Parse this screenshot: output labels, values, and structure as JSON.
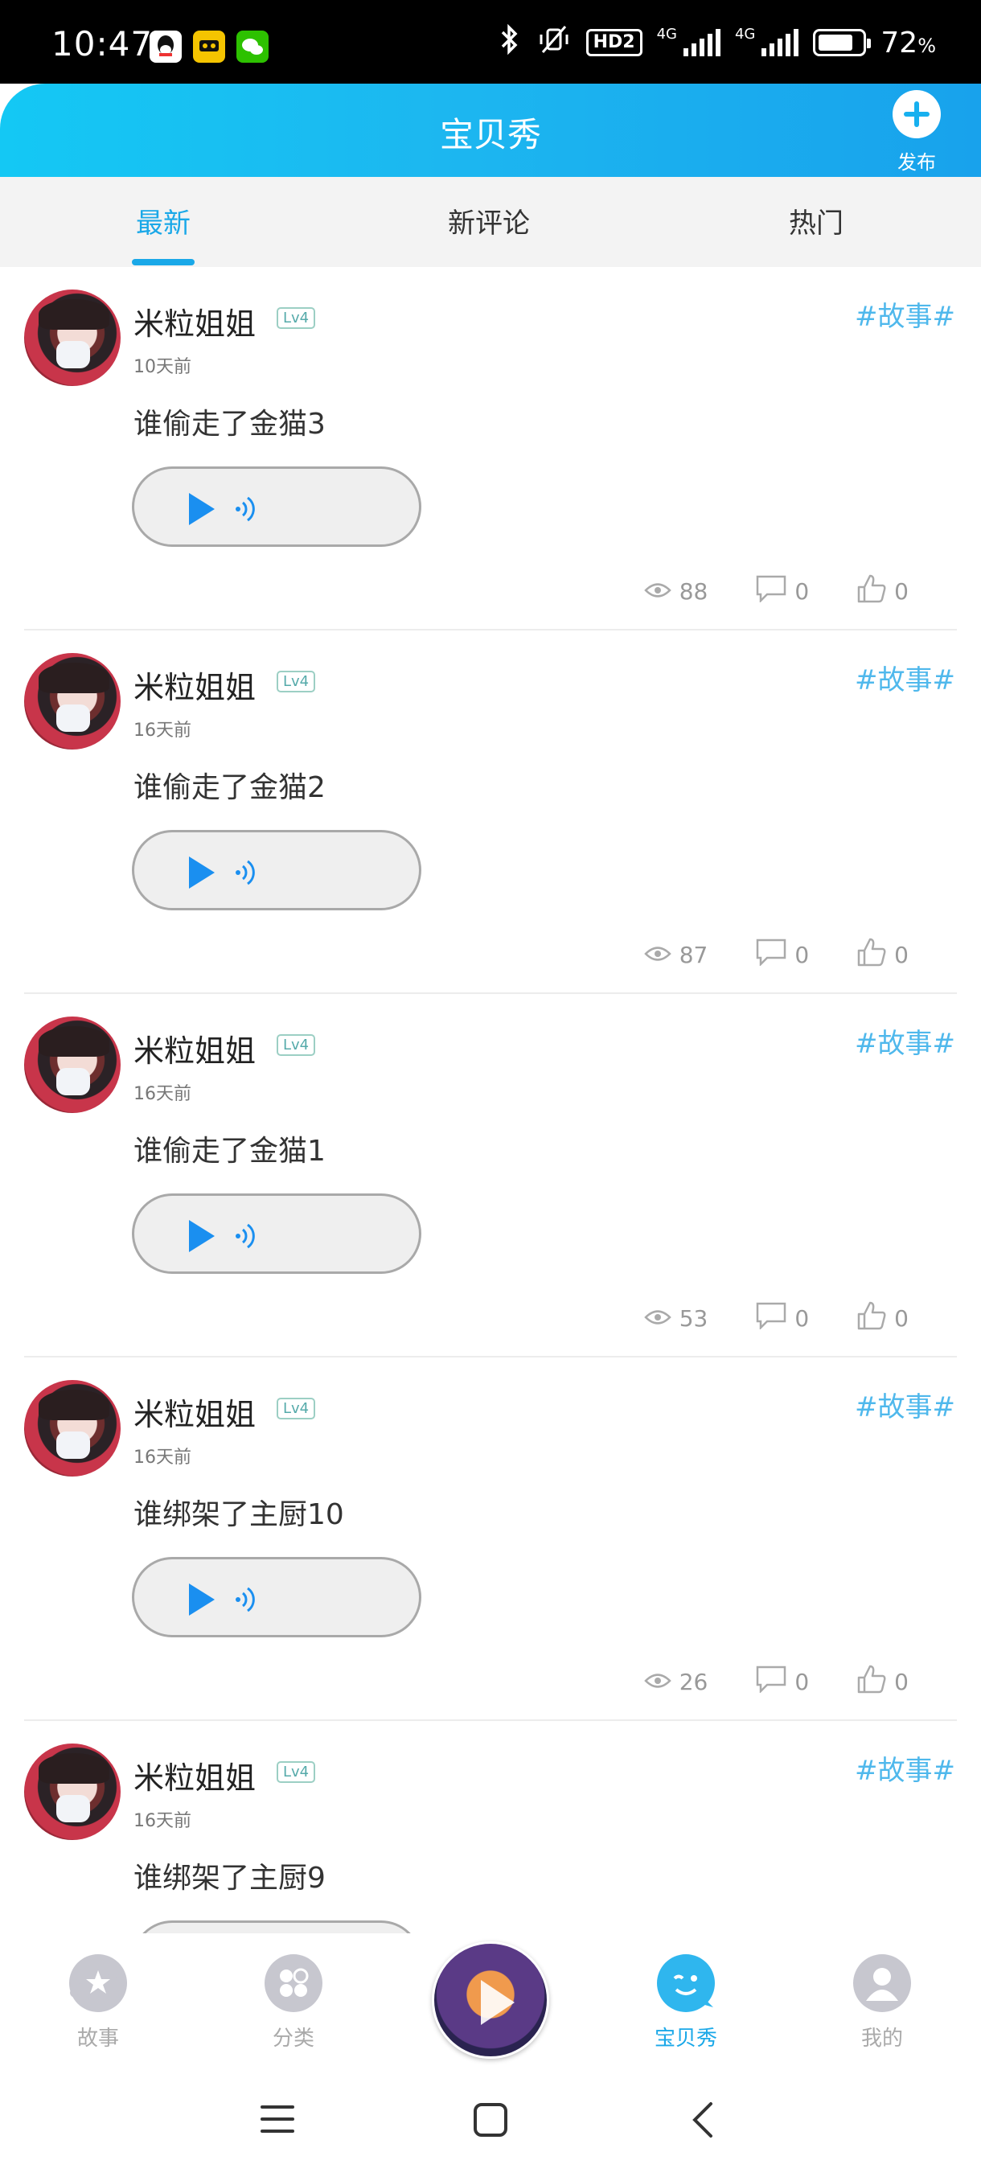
{
  "status_bar": {
    "time": "10:47",
    "hd_label": "HD2",
    "net1": "4G",
    "net2": "4G",
    "battery": "72",
    "battery_unit": "%"
  },
  "header": {
    "title": "宝贝秀",
    "publish_label": "发布"
  },
  "tabs": [
    {
      "label": "最新",
      "active": true
    },
    {
      "label": "新评论",
      "active": false
    },
    {
      "label": "热门",
      "active": false
    }
  ],
  "posts": [
    {
      "author": "米粒姐姐",
      "level": "Lv4",
      "time": "10天前",
      "tag": "#故事#",
      "title": "谁偷走了金猫3",
      "views": "88",
      "comments": "0",
      "likes": "0"
    },
    {
      "author": "米粒姐姐",
      "level": "Lv4",
      "time": "16天前",
      "tag": "#故事#",
      "title": "谁偷走了金猫2",
      "views": "87",
      "comments": "0",
      "likes": "0"
    },
    {
      "author": "米粒姐姐",
      "level": "Lv4",
      "time": "16天前",
      "tag": "#故事#",
      "title": "谁偷走了金猫1",
      "views": "53",
      "comments": "0",
      "likes": "0"
    },
    {
      "author": "米粒姐姐",
      "level": "Lv4",
      "time": "16天前",
      "tag": "#故事#",
      "title": "谁绑架了主厨10",
      "views": "26",
      "comments": "0",
      "likes": "0"
    },
    {
      "author": "米粒姐姐",
      "level": "Lv4",
      "time": "16天前",
      "tag": "#故事#",
      "title": "谁绑架了主厨9",
      "views": "",
      "comments": "",
      "likes": ""
    }
  ],
  "bottom_nav": [
    {
      "label": "故事",
      "icon": "planet-star-icon",
      "active": false
    },
    {
      "label": "分类",
      "icon": "category-icon",
      "active": false
    },
    {
      "label": "宝贝秀",
      "icon": "wink-bubble-icon",
      "active": true
    },
    {
      "label": "我的",
      "icon": "user-icon",
      "active": false
    }
  ],
  "colors": {
    "accent": "#1aa8e8",
    "header_start": "#14c8f4",
    "header_end": "#18a2ec",
    "play": "#1a8ff0"
  }
}
